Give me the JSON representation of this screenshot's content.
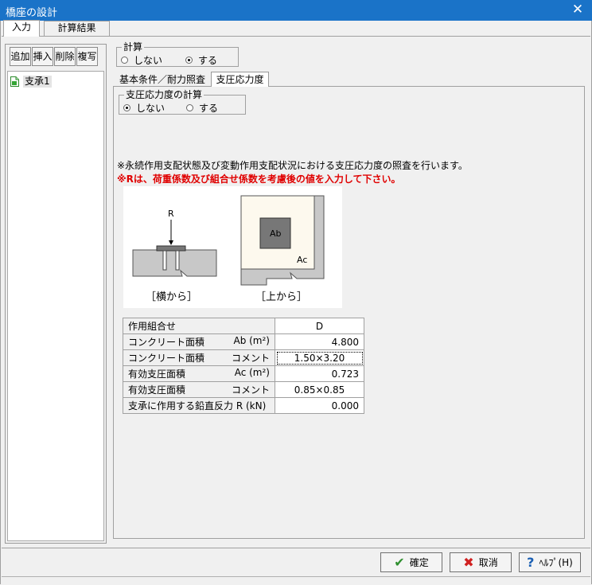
{
  "window": {
    "title": "橋座の設計",
    "close": "✕"
  },
  "top_tabs": [
    {
      "label": "入力"
    },
    {
      "label": "計算結果"
    }
  ],
  "toolbar": {
    "add": "追加",
    "insert": "挿入",
    "delete": "削除",
    "copy": "複写"
  },
  "tree": {
    "items": [
      {
        "label": "支承1"
      }
    ]
  },
  "calc_group": {
    "title": "計算",
    "options": [
      "しない",
      "する"
    ],
    "selected": "する"
  },
  "sub_tabs": [
    {
      "label": "基本条件／耐力照査"
    },
    {
      "label": "支圧応力度"
    }
  ],
  "bearing_group": {
    "title": "支圧応力度の計算",
    "options": [
      "しない",
      "する"
    ],
    "selected": "しない"
  },
  "notes": {
    "line1": "※永続作用支配状態及び変動作用支配状況における支圧応力度の照査を行います。",
    "line2": "※Rは、荷重係数及び組合せ係数を考慮後の値を入力して下さい。"
  },
  "diagram": {
    "side_label": "［横から］",
    "top_label": "［上から］",
    "r_label": "R",
    "ab_label": "Ab",
    "ac_label": "Ac"
  },
  "table": {
    "rows": [
      {
        "label": "作用組合せ",
        "unit": "",
        "value": "D"
      },
      {
        "label": "コンクリート面積",
        "unit": "Ab (m²)",
        "value": "4.800"
      },
      {
        "label": "コンクリート面積",
        "unit": "コメント",
        "value": "1.50×3.20"
      },
      {
        "label": "有効支圧面積",
        "unit": "Ac (m²)",
        "value": "0.723"
      },
      {
        "label": "有効支圧面積",
        "unit": "コメント",
        "value": "0.85×0.85"
      },
      {
        "label": "支承に作用する鉛直反力 R (kN)",
        "unit": "",
        "value": "0.000"
      }
    ]
  },
  "buttons": {
    "ok": "確定",
    "cancel": "取消",
    "help": "ﾍﾙﾌﾟ(H)"
  }
}
